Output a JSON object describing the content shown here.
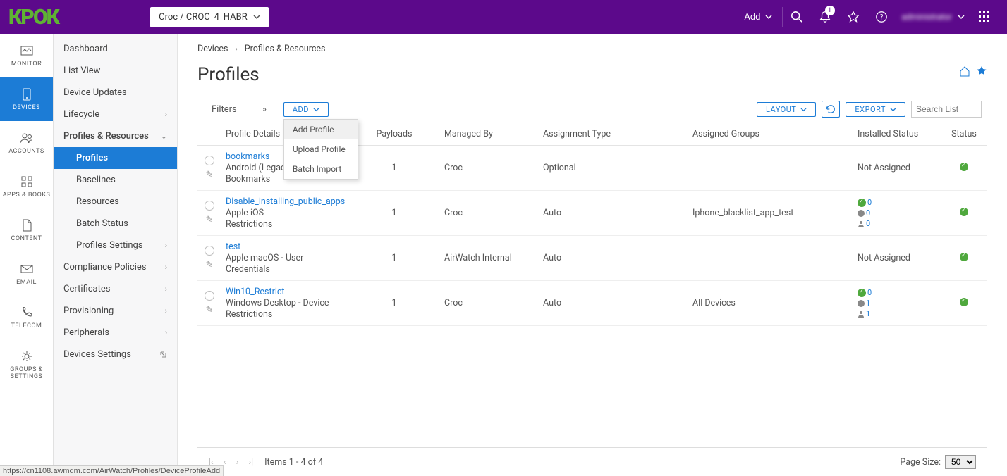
{
  "topbar": {
    "logo": "КРОК",
    "switcher_label": "Croc / CROC_4_HABR",
    "add_label": "Add",
    "notif_count": "1",
    "username": "administrator"
  },
  "leftnav": {
    "monitor": "MONITOR",
    "devices": "DEVICES",
    "accounts": "ACCOUNTS",
    "apps_books": "APPS & BOOKS",
    "content": "CONTENT",
    "email": "EMAIL",
    "telecom": "TELECOM",
    "groups_settings": "GROUPS & SETTINGS"
  },
  "sidebar": {
    "dashboard": "Dashboard",
    "list_view": "List View",
    "device_updates": "Device Updates",
    "lifecycle": "Lifecycle",
    "profiles_resources": "Profiles & Resources",
    "profiles": "Profiles",
    "baselines": "Baselines",
    "resources": "Resources",
    "batch_status": "Batch Status",
    "profiles_settings": "Profiles Settings",
    "compliance_policies": "Compliance Policies",
    "certificates": "Certificates",
    "provisioning": "Provisioning",
    "peripherals": "Peripherals",
    "devices_settings": "Devices Settings"
  },
  "breadcrumb": {
    "devices": "Devices",
    "current": "Profiles & Resources"
  },
  "page_title": "Profiles",
  "toolbar": {
    "filters": "Filters",
    "add_btn": "ADD",
    "layout_btn": "LAYOUT",
    "export_btn": "EXPORT",
    "search_placeholder": "Search List"
  },
  "dropdown": {
    "add_profile": "Add Profile",
    "upload_profile": "Upload Profile",
    "batch_import": "Batch Import"
  },
  "columns": {
    "details": "Profile Details",
    "payloads": "Payloads",
    "managed_by": "Managed By",
    "assignment_type": "Assignment Type",
    "assigned_groups": "Assigned Groups",
    "installed_status": "Installed Status",
    "status": "Status"
  },
  "rows": [
    {
      "name": "bookmarks",
      "desc1": "Android (Legacy)",
      "desc2": "Bookmarks",
      "payloads": "1",
      "managed_by": "Croc",
      "assign": "Optional",
      "groups": "",
      "install_text": "Not Assigned",
      "install_icons": false
    },
    {
      "name": "Disable_installing_public_apps",
      "desc1": "Apple iOS",
      "desc2": "Restrictions",
      "payloads": "1",
      "managed_by": "Croc",
      "assign": "Auto",
      "groups": "Iphone_blacklist_app_test",
      "install_text": "",
      "install_icons": true,
      "ic_g": "0",
      "ic_d": "0",
      "ic_u": "0"
    },
    {
      "name": "test",
      "desc1": "Apple macOS - User",
      "desc2": "Credentials",
      "payloads": "1",
      "managed_by": "AirWatch Internal",
      "assign": "Auto",
      "groups": "",
      "install_text": "Not Assigned",
      "install_icons": false
    },
    {
      "name": "Win10_Restrict",
      "desc1": "Windows Desktop - Device",
      "desc2": "Restrictions",
      "payloads": "1",
      "managed_by": "Croc",
      "assign": "Auto",
      "groups": "All Devices",
      "install_text": "",
      "install_icons": true,
      "ic_g": "0",
      "ic_d": "1",
      "ic_u": "1"
    }
  ],
  "footer": {
    "items_label": "Items 1 - 4 of 4",
    "page_size_label": "Page Size:",
    "page_size_value": "50"
  },
  "status_url": "https://cn1108.awmdm.com/AirWatch/Profiles/DeviceProfileAdd"
}
